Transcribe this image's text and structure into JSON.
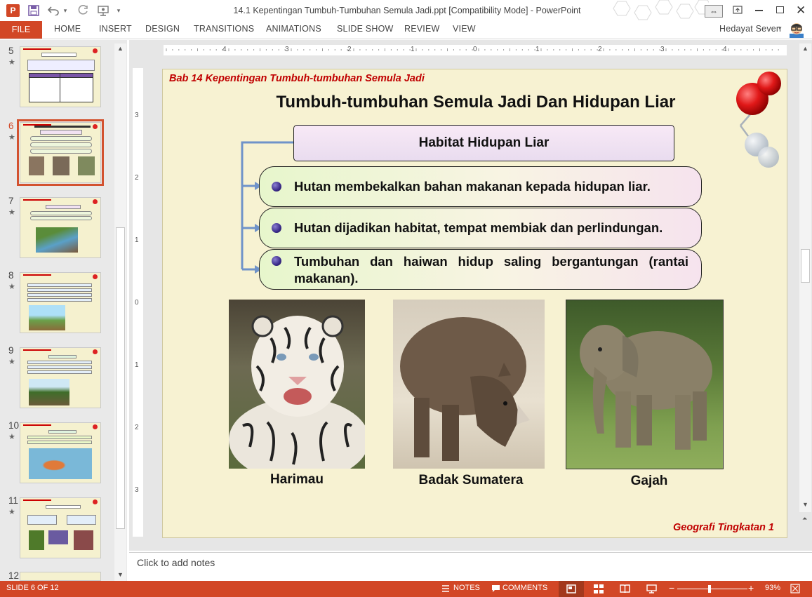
{
  "window": {
    "title": "14.1 Kepentingan Tumbuh-Tumbuhan Semula  Jadi.ppt [Compatibility Mode] - PowerPoint",
    "user": "Hedayat Seven",
    "app_icon": "P"
  },
  "ribbon": {
    "file": "FILE",
    "tabs": [
      "HOME",
      "INSERT",
      "DESIGN",
      "TRANSITIONS",
      "ANIMATIONS",
      "SLIDE SHOW",
      "REVIEW",
      "VIEW"
    ]
  },
  "thumbnails": [
    {
      "num": "5",
      "star": "★"
    },
    {
      "num": "6",
      "star": "★"
    },
    {
      "num": "7",
      "star": "★"
    },
    {
      "num": "8",
      "star": "★"
    },
    {
      "num": "9",
      "star": "★"
    },
    {
      "num": "10",
      "star": "★"
    },
    {
      "num": "11",
      "star": "★"
    },
    {
      "num": "12"
    }
  ],
  "ruler": {
    "h": [
      "4",
      "3",
      "2",
      "1",
      "0",
      "1",
      "2",
      "3",
      "4"
    ],
    "v": [
      "3",
      "2",
      "1",
      "0",
      "1",
      "2",
      "3"
    ]
  },
  "slide": {
    "chapter": "Bab 14 Kepentingan Tumbuh-tumbuhan Semula Jadi",
    "title": "Tumbuh-tumbuhan Semula Jadi Dan Hidupan Liar",
    "box_heading": "Habitat Hidupan Liar",
    "bullets": [
      "Hutan membekalkan bahan makanan kepada hidupan liar.",
      "Hutan dijadikan habitat, tempat membiak dan perlindungan.",
      "Tumbuhan dan haiwan hidup saling bergantungan (rantai makanan)."
    ],
    "photos": [
      "Harimau",
      "Badak Sumatera",
      "Gajah"
    ],
    "footer": "Geografi Tingkatan 1",
    "accent_red": "#c00000"
  },
  "notes": {
    "placeholder": "Click to add notes"
  },
  "status": {
    "slide_info": "SLIDE 6 OF 12",
    "notes": "NOTES",
    "comments": "COMMENTS",
    "zoom": "93%"
  },
  "colors": {
    "brand": "#d24726",
    "pane": "#e9e9e9"
  }
}
